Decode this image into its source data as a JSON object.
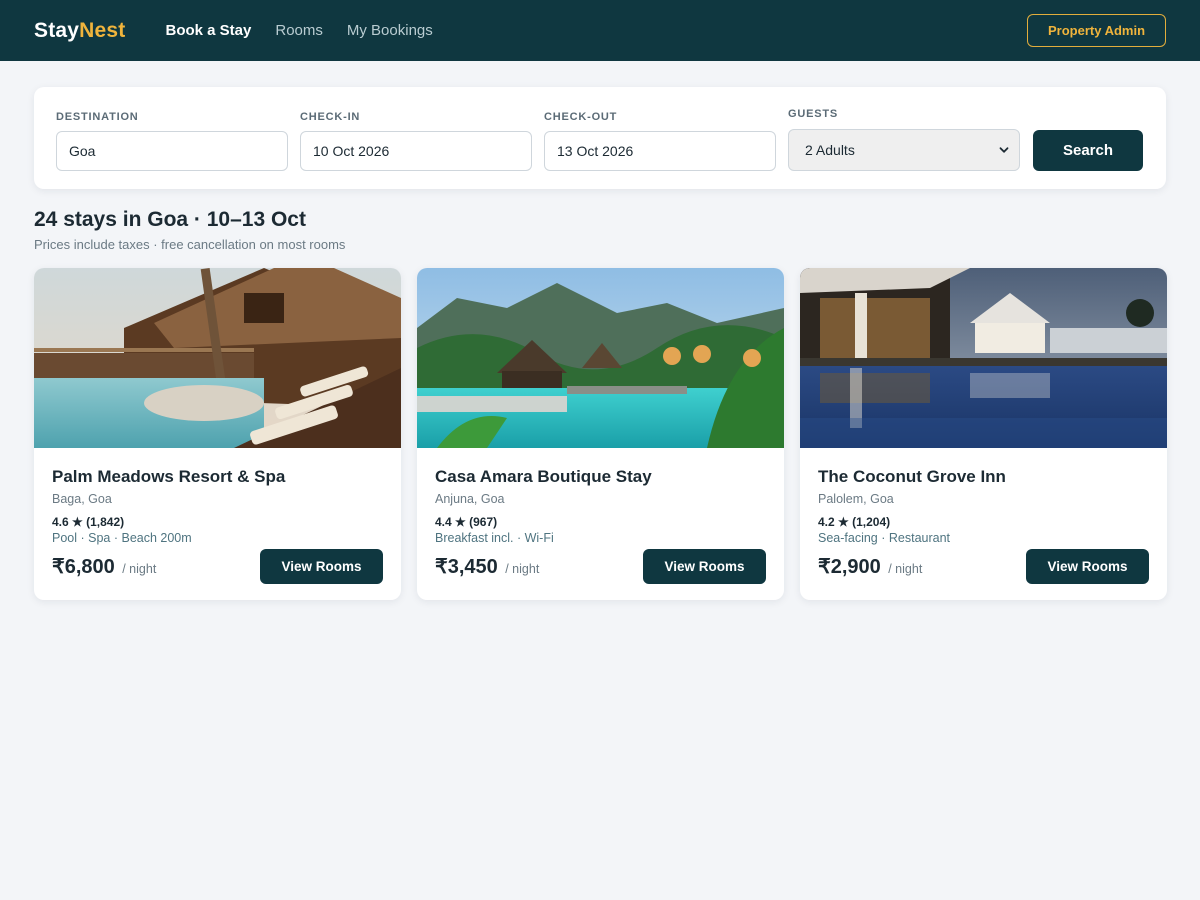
{
  "header": {
    "logo_main": "Stay",
    "logo_accent": "Nest",
    "nav": [
      {
        "label": "Book a Stay"
      },
      {
        "label": "Rooms"
      },
      {
        "label": "My Bookings"
      }
    ],
    "admin_label": "Property Admin"
  },
  "search": {
    "destination_label": "DESTINATION",
    "destination_value": "Goa",
    "checkin_label": "CHECK-IN",
    "checkin_value": "10 Oct 2026",
    "checkout_label": "CHECK-OUT",
    "checkout_value": "13 Oct 2026",
    "guests_label": "GUESTS",
    "guests_value": "2 Adults",
    "button_label": "Search"
  },
  "results": {
    "title": "24 stays in Goa · 10–13 Oct",
    "subtitle": "Prices include taxes · free cancellation on most rooms"
  },
  "stays": [
    {
      "name": "Palm Meadows Resort & Spa",
      "location": "Baga, Goa",
      "rating": "4.6 ★ (1,842)",
      "amenities": "Pool · Spa · Beach 200m",
      "price": "₹6,800",
      "per": "/ night",
      "button": "View Rooms"
    },
    {
      "name": "Casa Amara Boutique Stay",
      "location": "Anjuna, Goa",
      "rating": "4.4 ★ (967)",
      "amenities": "Breakfast incl. · Wi-Fi",
      "price": "₹3,450",
      "per": "/ night",
      "button": "View Rooms"
    },
    {
      "name": "The Coconut Grove Inn",
      "location": "Palolem, Goa",
      "rating": "4.2 ★ (1,204)",
      "amenities": "Sea-facing · Restaurant",
      "price": "₹2,900",
      "per": "/ night",
      "button": "View Rooms"
    }
  ],
  "colors": {
    "primary": "#0f3740",
    "accent": "#f0b43c",
    "background": "#f3f5f8"
  }
}
